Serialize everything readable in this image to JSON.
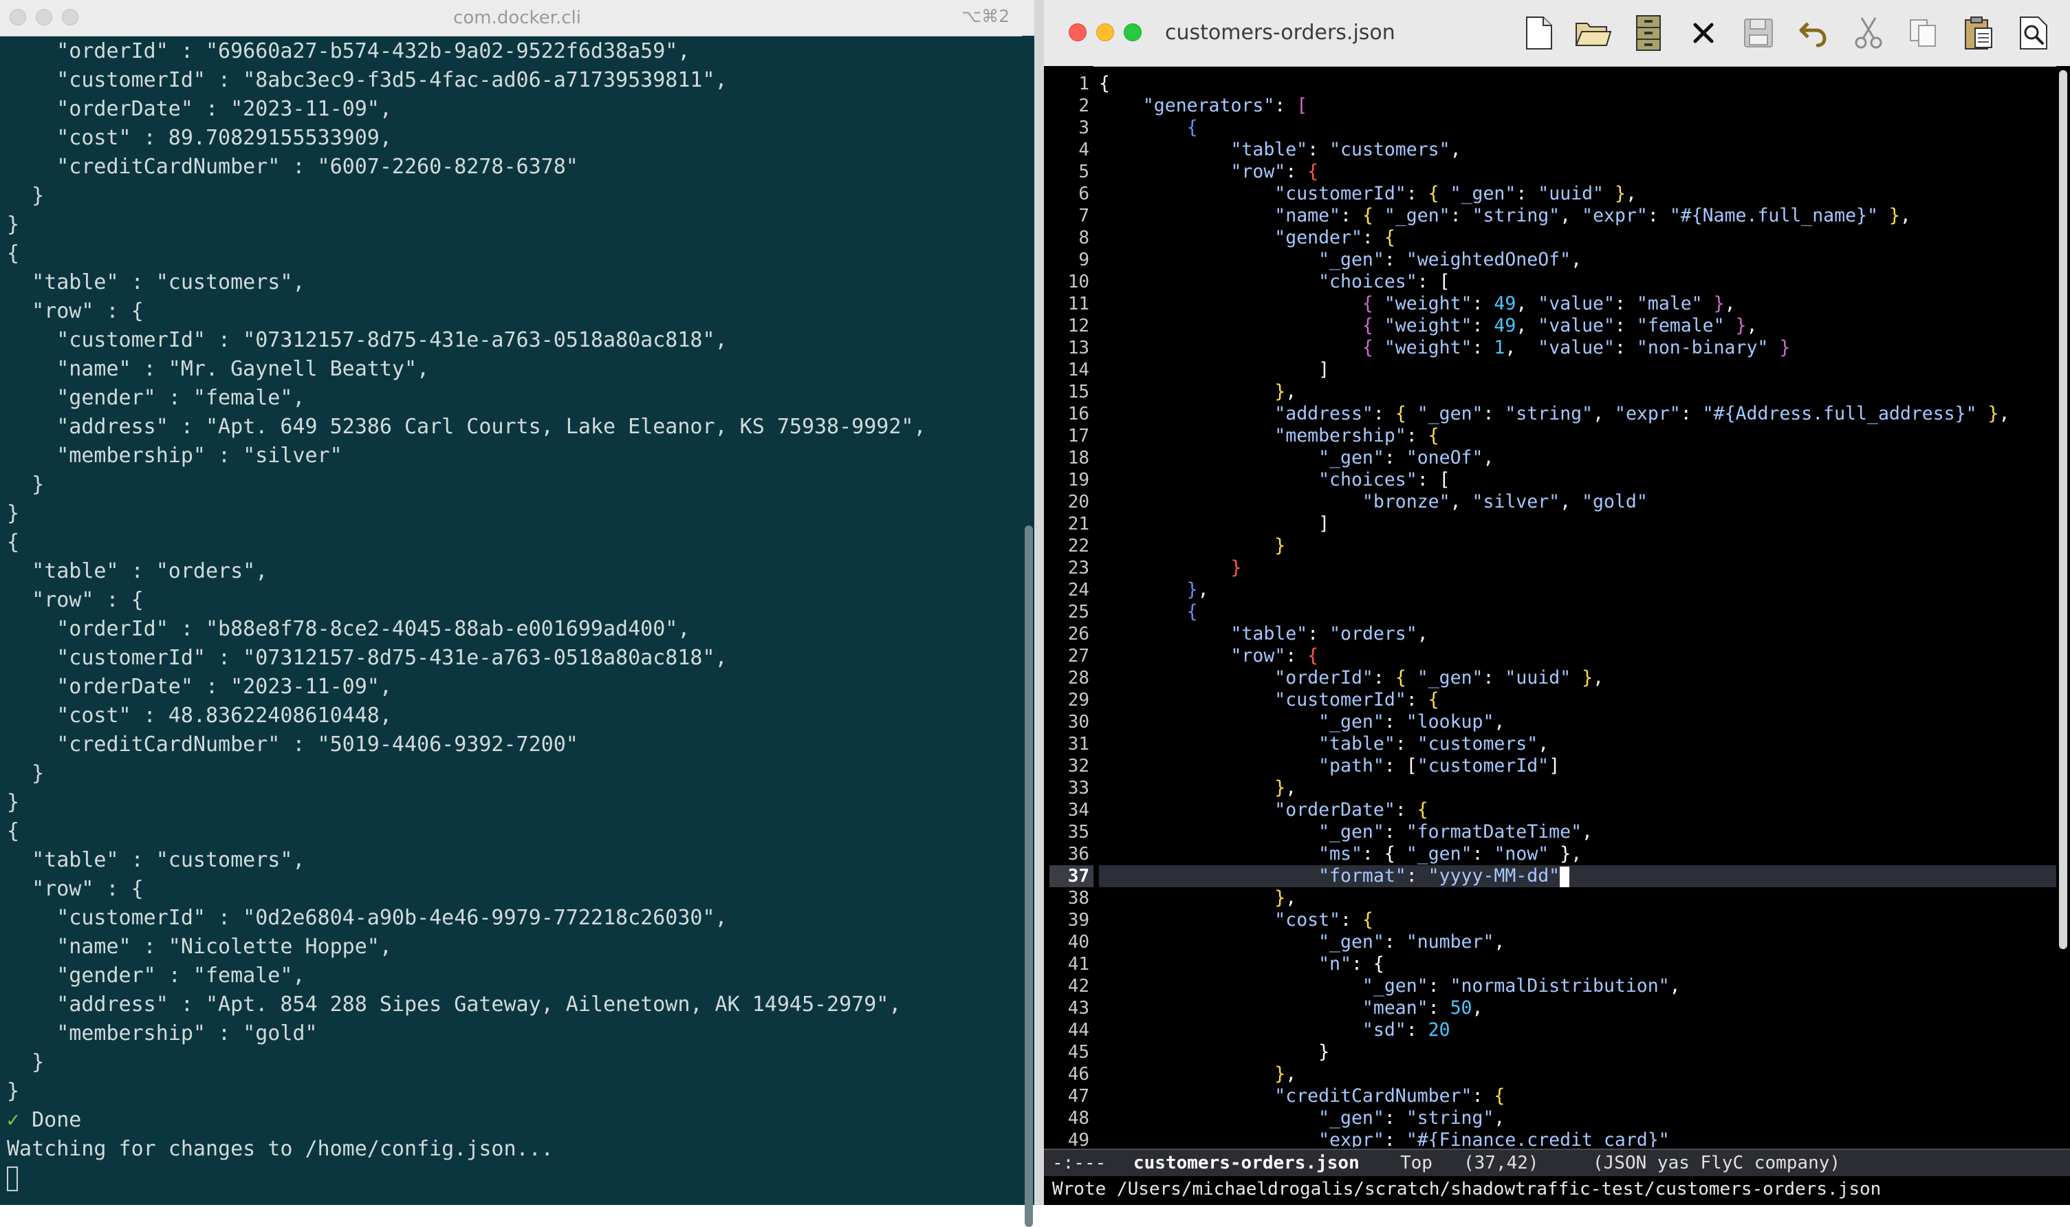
{
  "terminal": {
    "title": "com.docker.cli",
    "shortcut": "⌥⌘2",
    "lines": [
      "    \"orderId\" : \"69660a27-b574-432b-9a02-9522f6d38a59\",",
      "    \"customerId\" : \"8abc3ec9-f3d5-4fac-ad06-a71739539811\",",
      "    \"orderDate\" : \"2023-11-09\",",
      "    \"cost\" : 89.70829155533909,",
      "    \"creditCardNumber\" : \"6007-2260-8278-6378\"",
      "  }",
      "}",
      "{",
      "  \"table\" : \"customers\",",
      "  \"row\" : {",
      "    \"customerId\" : \"07312157-8d75-431e-a763-0518a80ac818\",",
      "    \"name\" : \"Mr. Gaynell Beatty\",",
      "    \"gender\" : \"female\",",
      "    \"address\" : \"Apt. 649 52386 Carl Courts, Lake Eleanor, KS 75938-9992\",",
      "    \"membership\" : \"silver\"",
      "  }",
      "}",
      "{",
      "  \"table\" : \"orders\",",
      "  \"row\" : {",
      "    \"orderId\" : \"b88e8f78-8ce2-4045-88ab-e001699ad400\",",
      "    \"customerId\" : \"07312157-8d75-431e-a763-0518a80ac818\",",
      "    \"orderDate\" : \"2023-11-09\",",
      "    \"cost\" : 48.83622408610448,",
      "    \"creditCardNumber\" : \"5019-4406-9392-7200\"",
      "  }",
      "}",
      "{",
      "  \"table\" : \"customers\",",
      "  \"row\" : {",
      "    \"customerId\" : \"0d2e6804-a90b-4e46-9979-772218c26030\",",
      "    \"name\" : \"Nicolette Hoppe\",",
      "    \"gender\" : \"female\",",
      "    \"address\" : \"Apt. 854 288 Sipes Gateway, Ailenetown, AK 14945-2979\",",
      "    \"membership\" : \"gold\"",
      "  }",
      "}"
    ],
    "done_mark": "✓",
    "done_text": "Done",
    "watching_text": "Watching for changes to /home/config.json..."
  },
  "editor": {
    "title": "customers-orders.json",
    "toolbar": [
      "new-file-icon",
      "open-folder-icon",
      "file-cabinet-icon",
      "close-icon",
      "save-icon",
      "undo-icon",
      "cut-icon",
      "copy-icon",
      "paste-icon",
      "search-icon"
    ],
    "current_line": 37,
    "code_lines": [
      "{",
      "    \"generators\": [",
      "        {",
      "            \"table\": \"customers\",",
      "            \"row\": {",
      "                \"customerId\": { \"_gen\": \"uuid\" },",
      "                \"name\": { \"_gen\": \"string\", \"expr\": \"#{Name.full_name}\" },",
      "                \"gender\": {",
      "                    \"_gen\": \"weightedOneOf\",",
      "                    \"choices\": [",
      "                        { \"weight\": 49, \"value\": \"male\" },",
      "                        { \"weight\": 49, \"value\": \"female\" },",
      "                        { \"weight\": 1,  \"value\": \"non-binary\" }",
      "                    ]",
      "                },",
      "                \"address\": { \"_gen\": \"string\", \"expr\": \"#{Address.full_address}\" },",
      "                \"membership\": {",
      "                    \"_gen\": \"oneOf\",",
      "                    \"choices\": [",
      "                        \"bronze\", \"silver\", \"gold\"",
      "                    ]",
      "                }",
      "            }",
      "        },",
      "        {",
      "            \"table\": \"orders\",",
      "            \"row\": {",
      "                \"orderId\": { \"_gen\": \"uuid\" },",
      "                \"customerId\": {",
      "                    \"_gen\": \"lookup\",",
      "                    \"table\": \"customers\",",
      "                    \"path\": [\"customerId\"]",
      "                },",
      "                \"orderDate\": {",
      "                    \"_gen\": \"formatDateTime\",",
      "                    \"ms\": { \"_gen\": \"now\" },",
      "                    \"format\": \"yyyy-MM-dd\"",
      "                },",
      "                \"cost\": {",
      "                    \"_gen\": \"number\",",
      "                    \"n\": {",
      "                        \"_gen\": \"normalDistribution\",",
      "                        \"mean\": 50,",
      "                        \"sd\": 20",
      "                    }",
      "                },",
      "                \"creditCardNumber\": {",
      "                    \"_gen\": \"string\",",
      "                    \"expr\": \"#{Finance.credit_card}\""
    ],
    "modeline": {
      "status": "-:---",
      "buffer": "customers-orders.json",
      "position": "Top",
      "cursor": "(37,42)",
      "modes": "(JSON yas FlyC company)"
    },
    "echo_area": "Wrote /Users/michaeldrogalis/scratch/shadowtraffic-test/customers-orders.json"
  },
  "colors": {
    "terminal_bg": "#0b3640",
    "terminal_text": "#d2dadb",
    "editor_bg": "#000000",
    "json_key": "#a6c8ff",
    "json_number": "#49c6ff",
    "check_green": "#80c93b",
    "traffic_red": "#fe5f57",
    "traffic_yellow": "#febc2e",
    "traffic_green": "#28c840"
  }
}
